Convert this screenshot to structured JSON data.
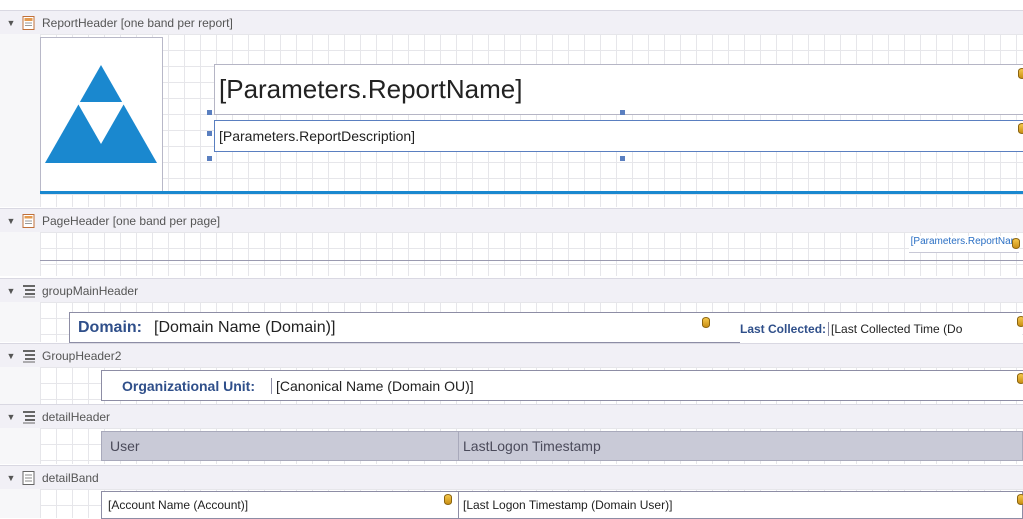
{
  "bands": {
    "report_header": {
      "caption": "ReportHeader [one band per report]"
    },
    "page_header": {
      "caption": "PageHeader [one band per page]"
    },
    "group_main_header": {
      "caption": "groupMainHeader"
    },
    "group_header2": {
      "caption": "GroupHeader2"
    },
    "detail_header": {
      "caption": "detailHeader"
    },
    "detail_band": {
      "caption": "detailBand"
    }
  },
  "report_header": {
    "report_name": "[Parameters.ReportName]",
    "report_description": "[Parameters.ReportDescription]"
  },
  "page_header": {
    "report_name_small": "[Parameters.ReportNam"
  },
  "group_main": {
    "domain_label": "Domain:",
    "domain_value": "[Domain Name (Domain)]",
    "last_collected_label": "Last Collected:",
    "last_collected_value": "[Last Collected Time (Do"
  },
  "group2": {
    "ou_label": "Organizational Unit:",
    "ou_value": "[Canonical Name (Domain OU)]"
  },
  "detail_header": {
    "col_user": "User",
    "col_last_logon": "LastLogon Timestamp"
  },
  "detail": {
    "account_name": "[Account Name (Account)]",
    "last_logon": "[Last Logon Timestamp (Domain User)]"
  },
  "colors": {
    "logo_blue": "#1a88cf",
    "band_caption_bg": "#f1f0f6",
    "header_cell_bg": "#c9cad7",
    "label_blue": "#2f4f8a",
    "separator_blue": "#1a88cf"
  },
  "icons": [
    "collapse-triangle-icon",
    "report-header-band-icon",
    "page-header-band-icon",
    "group-header-band-icon",
    "detail-header-band-icon",
    "detail-band-icon",
    "database-field-icon",
    "logo-triangle-image"
  ]
}
